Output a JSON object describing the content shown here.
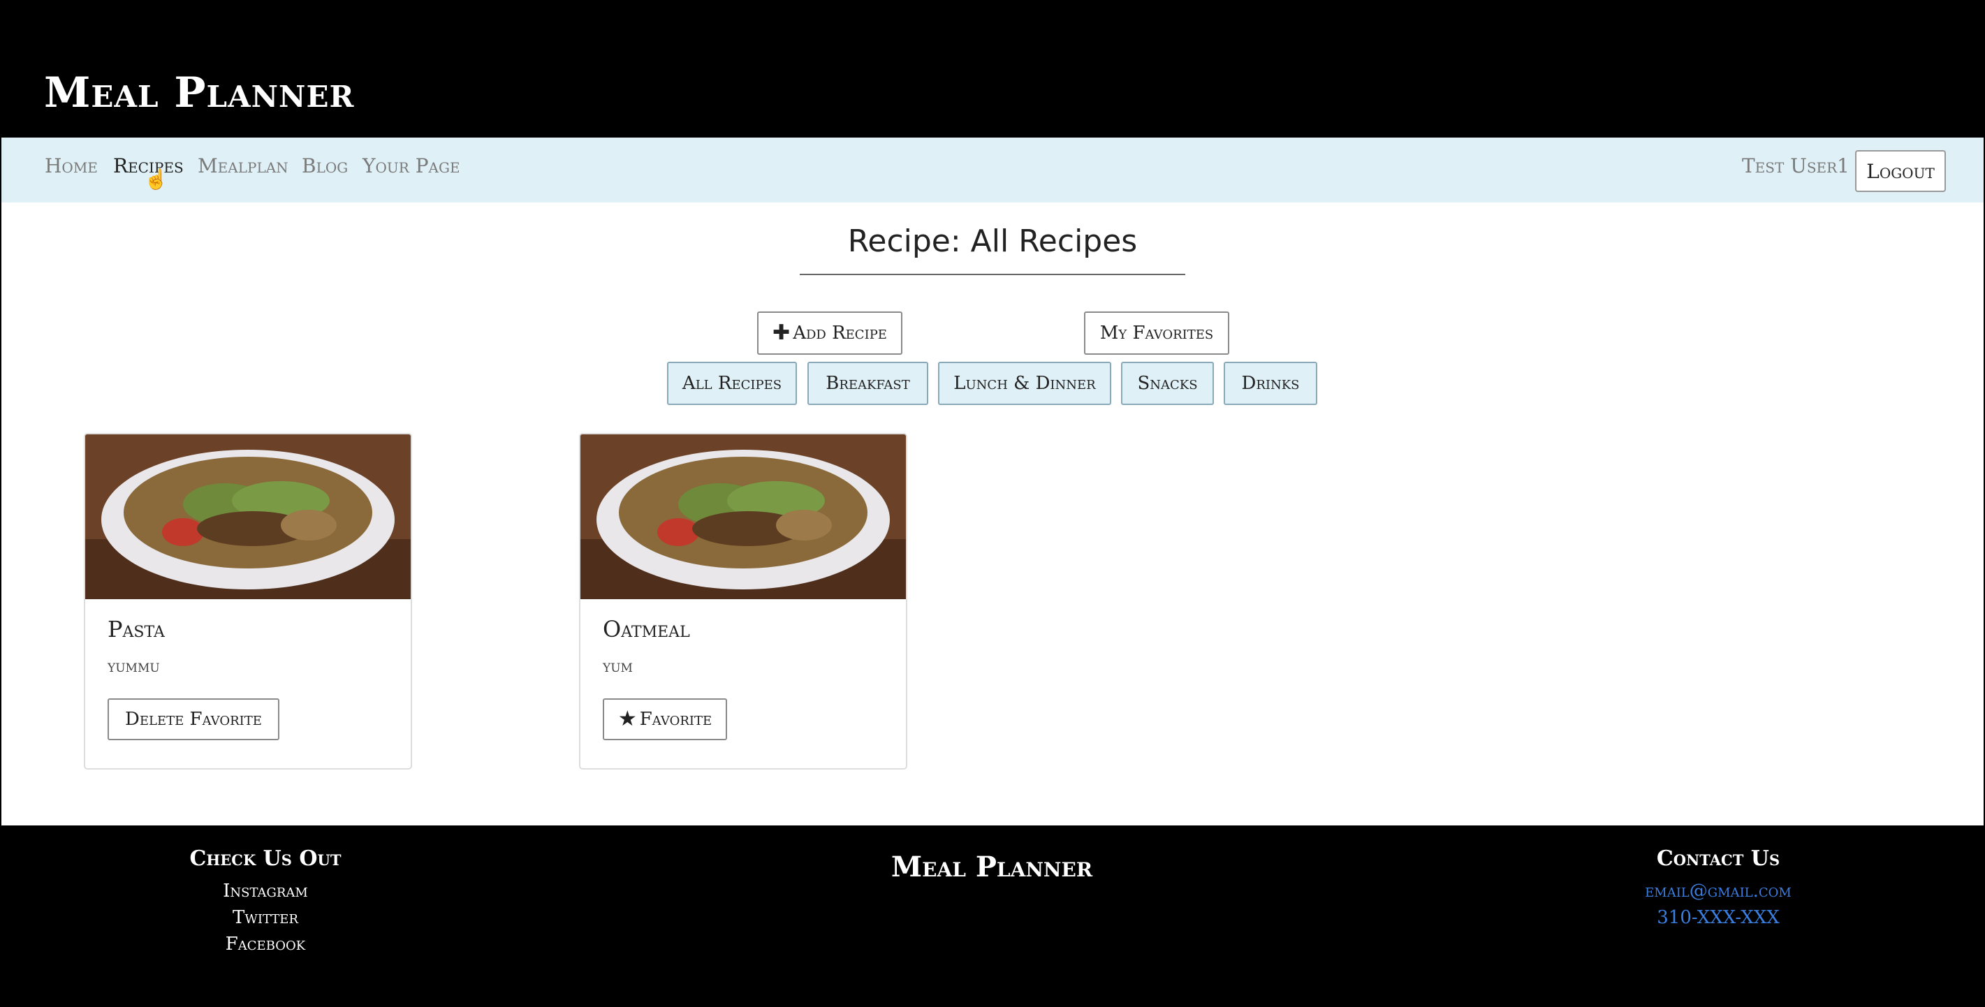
{
  "header": {
    "site_title": "Meal Planner"
  },
  "nav": {
    "items": [
      {
        "label": "Home"
      },
      {
        "label": "Recipes"
      },
      {
        "label": "Mealplan"
      },
      {
        "label": "Blog"
      },
      {
        "label": "Your Page"
      }
    ],
    "active": "Recipes",
    "user_name": "Test User1",
    "logout_label": "Logout"
  },
  "main": {
    "title": "Recipe: All Recipes",
    "add_recipe_label": "Add Recipe",
    "my_favorites_label": "My Favorites",
    "filters": [
      {
        "label": "All Recipes"
      },
      {
        "label": "Breakfast"
      },
      {
        "label": "Lunch & Dinner"
      },
      {
        "label": "Snacks"
      },
      {
        "label": "Drinks"
      }
    ],
    "recipes": [
      {
        "title": "Pasta",
        "description": "yummu",
        "button_label": "Delete Favorite",
        "button_icon": ""
      },
      {
        "title": "Oatmeal",
        "description": "yum",
        "button_label": "Favorite",
        "button_icon": "star-icon"
      }
    ]
  },
  "footer": {
    "check_heading": "Check Us Out",
    "social_links": [
      {
        "label": "Instagram"
      },
      {
        "label": "Twitter"
      },
      {
        "label": "Facebook"
      }
    ],
    "brand": "Meal Planner",
    "contact_heading": "Contact Us",
    "email": "email@gmail.com",
    "phone": "310-XXX-XXX"
  },
  "colors": {
    "nav_bg": "#dff0f7",
    "link_blue": "#3a7ee0",
    "header_bg": "#000000"
  }
}
